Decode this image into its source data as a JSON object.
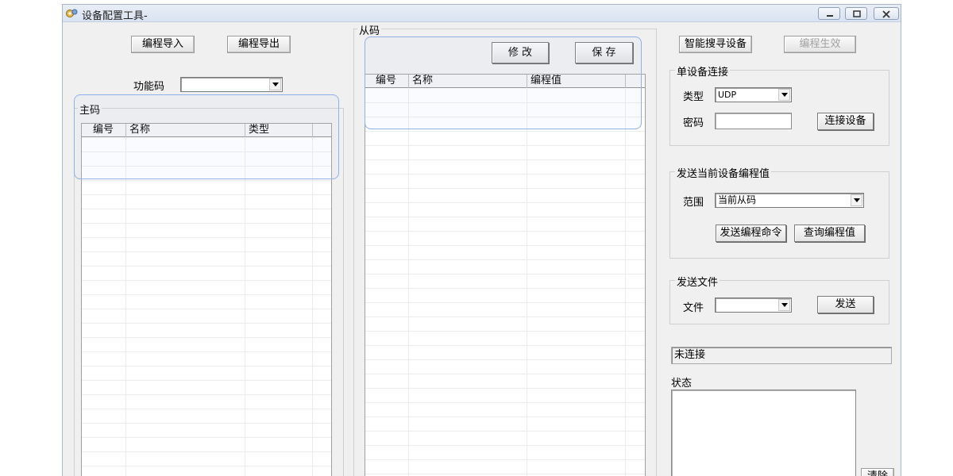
{
  "window": {
    "title": "设备配置工具-"
  },
  "toolbar": {
    "import_label": "编程导入",
    "export_label": "编程导出"
  },
  "function_code": {
    "label": "功能码",
    "value": ""
  },
  "master": {
    "legend": "主码",
    "columns": [
      "编号",
      "名称",
      "类型"
    ]
  },
  "slave": {
    "legend": "从码",
    "modify_label": "修 改",
    "save_label": "保 存",
    "columns": [
      "编号",
      "名称",
      "编程值"
    ]
  },
  "right": {
    "smart_search_label": "智能搜寻设备",
    "apply_label": "编程生效",
    "single_conn": {
      "legend": "单设备连接",
      "type_label": "类型",
      "type_value": "UDP",
      "password_label": "密码",
      "password_value": "",
      "connect_label": "连接设备"
    },
    "send_current": {
      "legend": "发送当前设备编程值",
      "range_label": "范围",
      "range_value": "当前从码",
      "send_cmd_label": "发送编程命令",
      "query_label": "查询编程值"
    },
    "send_file": {
      "legend": "发送文件",
      "file_label": "文件",
      "file_value": "",
      "send_label": "发送"
    },
    "connection_status": "未连接",
    "status_label": "状态",
    "clear_label": "清除"
  }
}
